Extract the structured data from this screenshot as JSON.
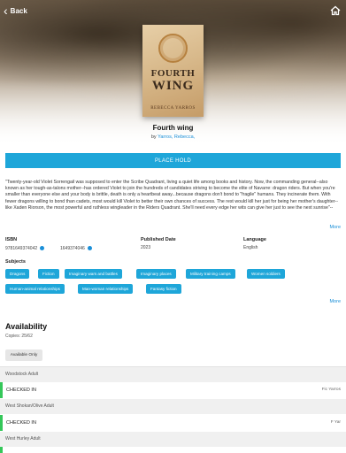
{
  "nav": {
    "back_label": "Back"
  },
  "book": {
    "cover_title_line1": "FOURTH",
    "cover_title_line2": "WING",
    "cover_author": "REBECCA YARROS",
    "title": "Fourth wing",
    "by_prefix": "by",
    "author": "Yarros, Rebecca,"
  },
  "actions": {
    "place_hold": "PLACE HOLD"
  },
  "description": {
    "text": "\"Twenty-year-old Violet Sorrengail was supposed to enter the Scribe Quadrant, living a quiet life among books and history. Now, the commanding general--also known as her tough-as-talons mother--has ordered Violet to join the hundreds of candidates striving to become the elite of Navarre: dragon riders. But when you're smaller than everyone else and your body is brittle, death is only a heartbeat away...because dragons don't bond to \"fragile\" humans. They incinerate them. With fewer dragons willing to bond than cadets, most would kill Violet to better their own chances of success. The rest would kill her just for being her mother's daughter--like Xaden Riorson, the most powerful and ruthless wingleader in the Riders Quadrant. She'll need every edge her wits can give her just to see the next sunrise\"--",
    "more_label": "More"
  },
  "details": {
    "isbn_label": "ISBN",
    "isbn_values": [
      "9781649374042",
      "1649374046"
    ],
    "published_label": "Published Date",
    "published_value": "2023",
    "language_label": "Language",
    "language_value": "English"
  },
  "subjects": {
    "label": "Subjects",
    "items": [
      "Dragons",
      "Fiction",
      "Imaginary wars and battles",
      "Imaginary places",
      "Military training camps",
      "Women soldiers",
      "Human-animal relationships",
      "Man-woman relationships",
      "Fantasy fiction"
    ],
    "more_label": "More"
  },
  "availability": {
    "heading": "Availability",
    "copies": "Copies: 25/62",
    "filter_label": "Available Only",
    "locations": [
      {
        "name": "Woodstock Adult",
        "status": "CHECKED IN",
        "shelf": "Fic Yarros"
      },
      {
        "name": "West Shokan/Olive Adult",
        "status": "CHECKED IN",
        "shelf": "F Yar"
      },
      {
        "name": "West Hurley Adult"
      }
    ]
  },
  "colors": {
    "accent": "#1ea6d9",
    "link": "#1a8fd8",
    "status_green": "#34c759"
  }
}
